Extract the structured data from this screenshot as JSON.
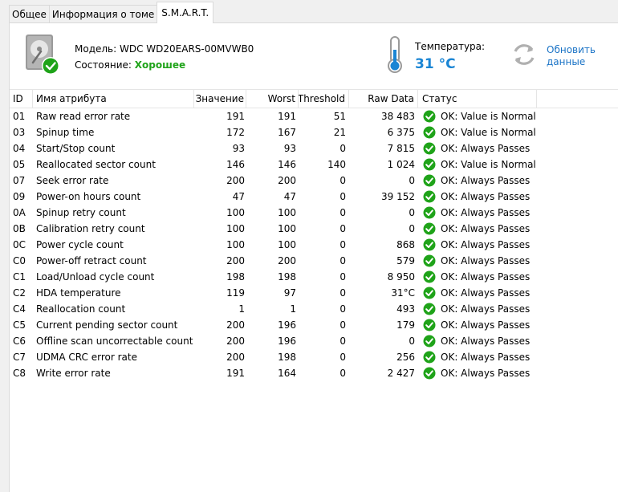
{
  "tabs": [
    {
      "label": "Общее"
    },
    {
      "label": "Информация о томе"
    },
    {
      "label": "S.M.A.R.T."
    }
  ],
  "header": {
    "model_label": "Модель:",
    "model_value": "WDC WD20EARS-00MVWB0",
    "state_label": "Состояние:",
    "state_value": "Хорошее",
    "temp_label": "Температура:",
    "temp_value": "31 °C",
    "refresh_label": "Обновить данные"
  },
  "colors": {
    "good": "#1fa319",
    "accent": "#1a85d4",
    "link": "#1a73c6"
  },
  "columns": [
    "ID",
    "Имя атрибута",
    "Значение",
    "Worst",
    "Threshold",
    "Raw Data",
    "Статус"
  ],
  "rows": [
    {
      "id": "01",
      "name": "Raw read error rate",
      "value": "191",
      "worst": "191",
      "threshold": "51",
      "raw": "38 483",
      "status": "OK: Value is Normal"
    },
    {
      "id": "03",
      "name": "Spinup time",
      "value": "172",
      "worst": "167",
      "threshold": "21",
      "raw": "6 375",
      "status": "OK: Value is Normal"
    },
    {
      "id": "04",
      "name": "Start/Stop count",
      "value": "93",
      "worst": "93",
      "threshold": "0",
      "raw": "7 815",
      "status": "OK: Always Passes"
    },
    {
      "id": "05",
      "name": "Reallocated sector count",
      "value": "146",
      "worst": "146",
      "threshold": "140",
      "raw": "1 024",
      "status": "OK: Value is Normal"
    },
    {
      "id": "07",
      "name": "Seek error rate",
      "value": "200",
      "worst": "200",
      "threshold": "0",
      "raw": "0",
      "status": "OK: Always Passes"
    },
    {
      "id": "09",
      "name": "Power-on hours count",
      "value": "47",
      "worst": "47",
      "threshold": "0",
      "raw": "39 152",
      "status": "OK: Always Passes"
    },
    {
      "id": "0A",
      "name": "Spinup retry count",
      "value": "100",
      "worst": "100",
      "threshold": "0",
      "raw": "0",
      "status": "OK: Always Passes"
    },
    {
      "id": "0B",
      "name": "Calibration retry count",
      "value": "100",
      "worst": "100",
      "threshold": "0",
      "raw": "0",
      "status": "OK: Always Passes"
    },
    {
      "id": "0C",
      "name": "Power cycle count",
      "value": "100",
      "worst": "100",
      "threshold": "0",
      "raw": "868",
      "status": "OK: Always Passes"
    },
    {
      "id": "C0",
      "name": "Power-off retract count",
      "value": "200",
      "worst": "200",
      "threshold": "0",
      "raw": "579",
      "status": "OK: Always Passes"
    },
    {
      "id": "C1",
      "name": "Load/Unload cycle count",
      "value": "198",
      "worst": "198",
      "threshold": "0",
      "raw": "8 950",
      "status": "OK: Always Passes"
    },
    {
      "id": "C2",
      "name": "HDA temperature",
      "value": "119",
      "worst": "97",
      "threshold": "0",
      "raw": "31°C",
      "status": "OK: Always Passes"
    },
    {
      "id": "C4",
      "name": "Reallocation count",
      "value": "1",
      "worst": "1",
      "threshold": "0",
      "raw": "493",
      "status": "OK: Always Passes"
    },
    {
      "id": "C5",
      "name": "Current pending sector count",
      "value": "200",
      "worst": "196",
      "threshold": "0",
      "raw": "179",
      "status": "OK: Always Passes"
    },
    {
      "id": "C6",
      "name": "Offline scan uncorrectable count",
      "value": "200",
      "worst": "196",
      "threshold": "0",
      "raw": "0",
      "status": "OK: Always Passes"
    },
    {
      "id": "C7",
      "name": "UDMA CRC error rate",
      "value": "200",
      "worst": "198",
      "threshold": "0",
      "raw": "256",
      "status": "OK: Always Passes"
    },
    {
      "id": "C8",
      "name": "Write error rate",
      "value": "191",
      "worst": "164",
      "threshold": "0",
      "raw": "2 427",
      "status": "OK: Always Passes"
    }
  ]
}
